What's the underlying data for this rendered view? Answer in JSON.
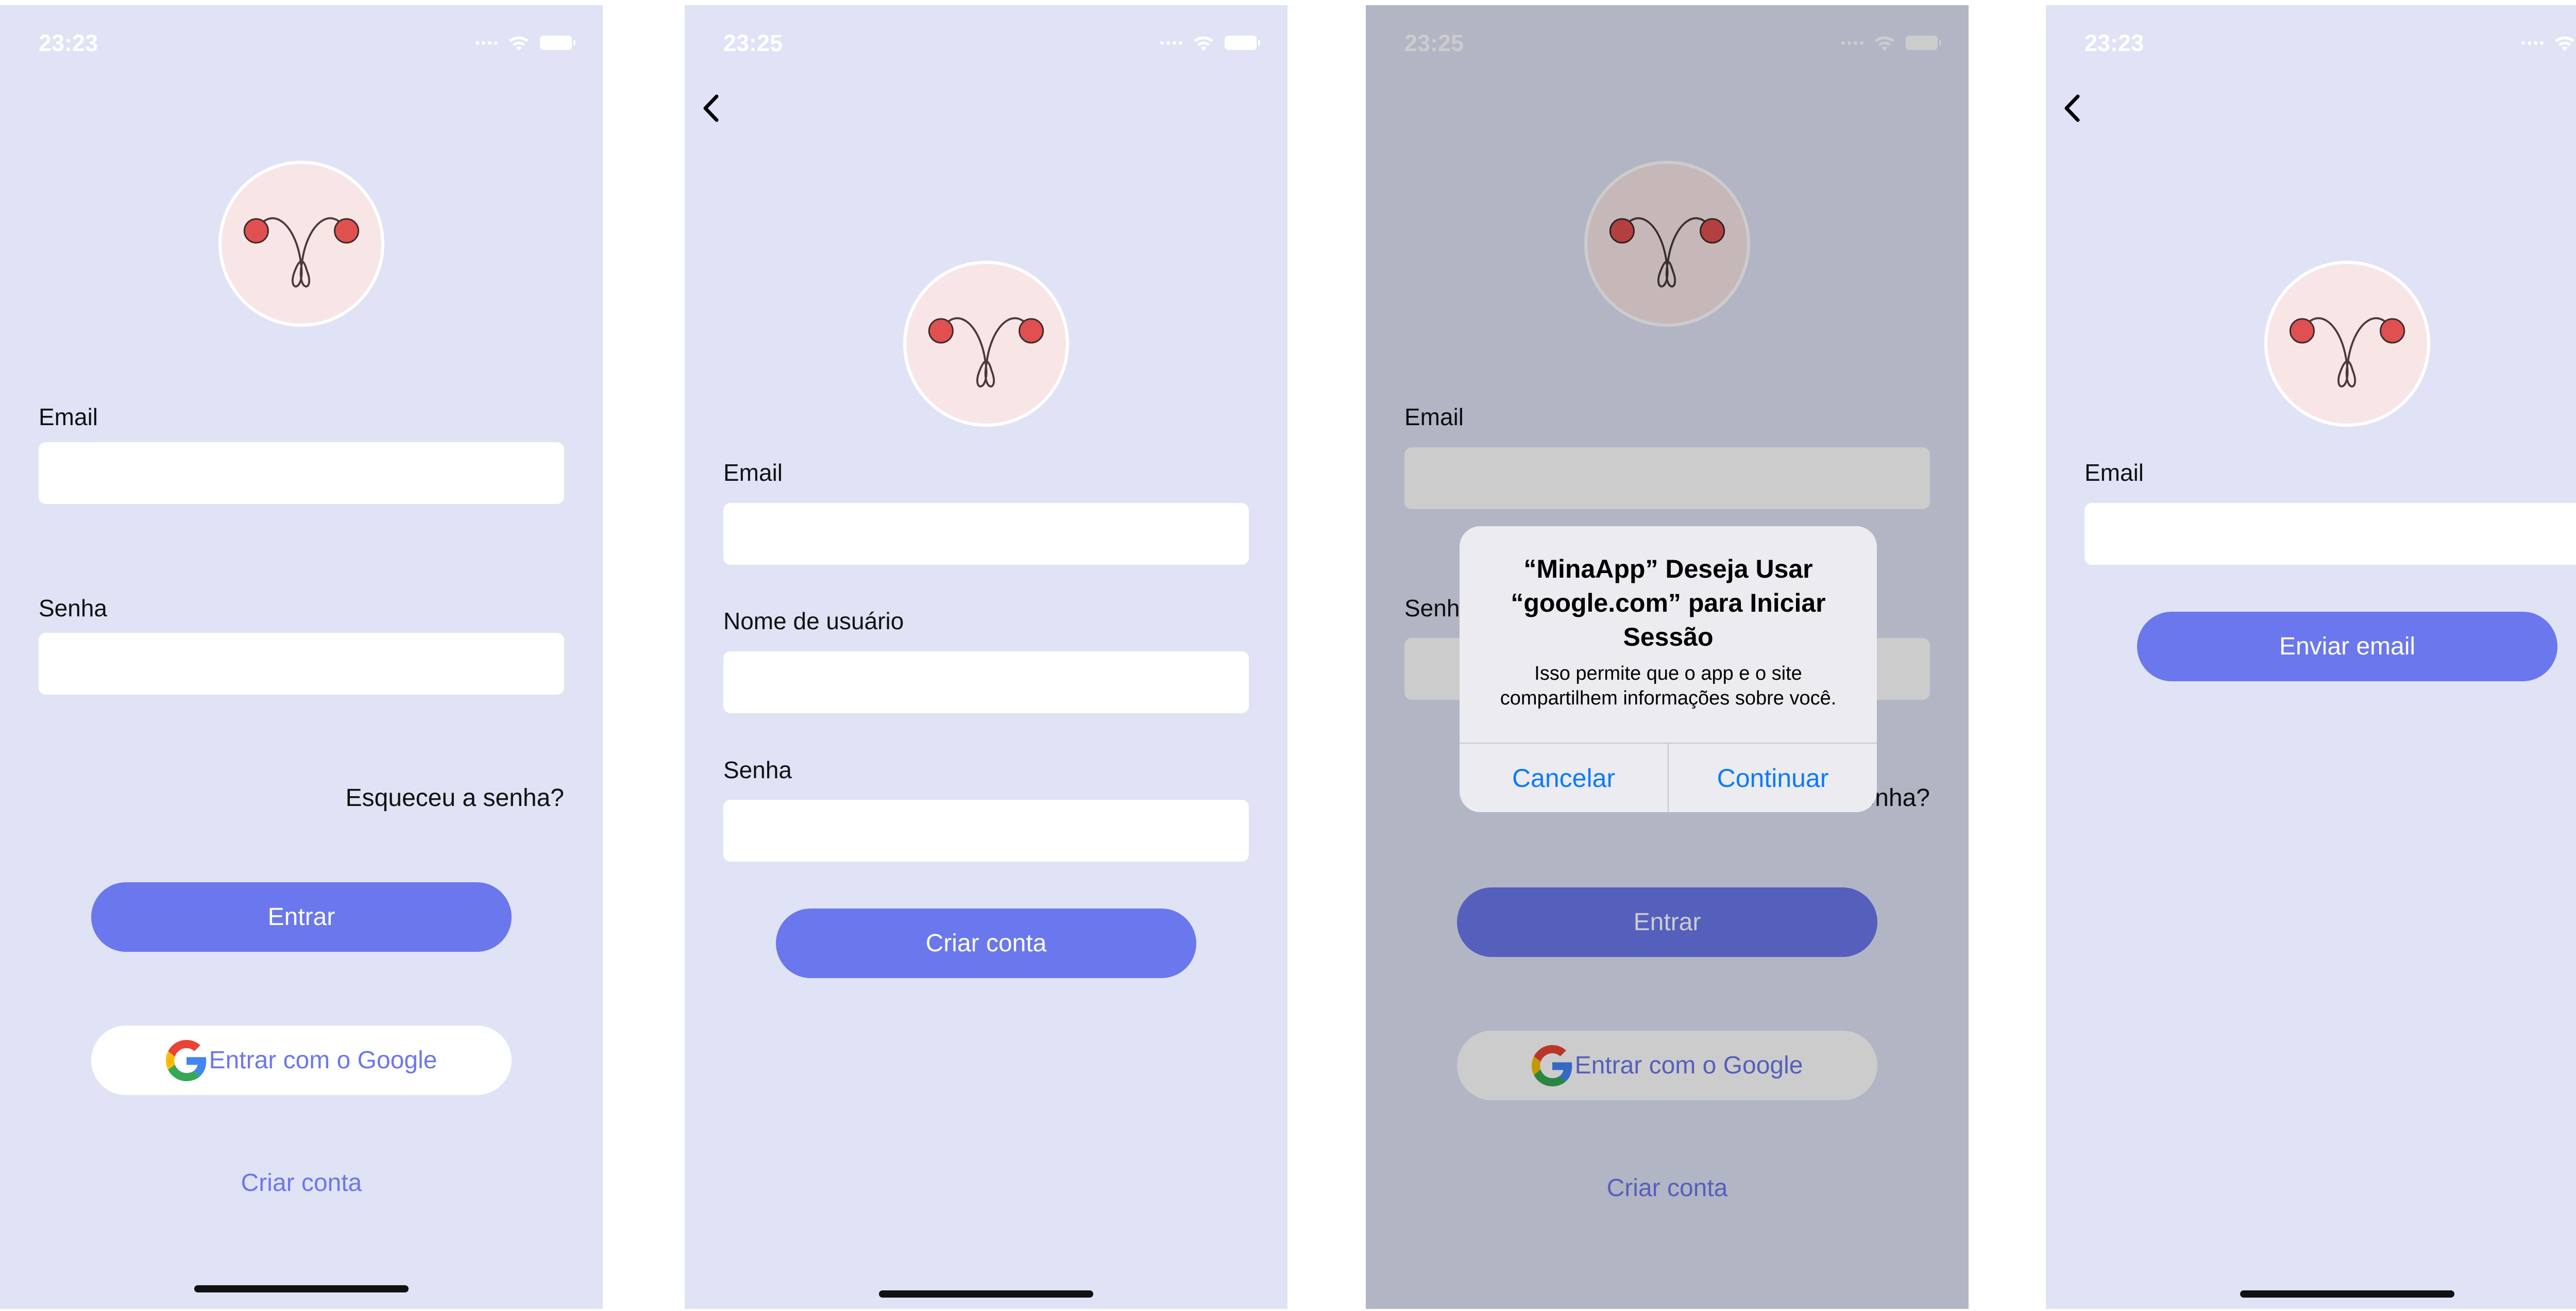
{
  "status_bar": {
    "time_a": "23:23",
    "time_b": "23:25"
  },
  "login": {
    "email_label": "Email",
    "password_label": "Senha",
    "forgot_link": "Esqueceu a senha?",
    "enter_button": "Entrar",
    "google_button": "Entrar com o Google",
    "create_account_link": "Criar conta"
  },
  "signup": {
    "email_label": "Email",
    "username_label": "Nome de usuário",
    "password_label": "Senha",
    "create_button": "Criar conta"
  },
  "alert": {
    "title": "“MinaApp” Deseja Usar “google.com” para Iniciar Sessão",
    "message": "Isso permite que o app e o site compartilhem informações sobre você.",
    "cancel_button": "Cancelar",
    "continue_button": "Continuar"
  },
  "reset": {
    "email_label": "Email",
    "send_button": "Enviar email"
  },
  "icons": [
    "chevron-left-icon",
    "wifi-icon",
    "battery-icon",
    "signal-icon",
    "google-g-icon",
    "app-logo-icon"
  ],
  "colors": {
    "background": "#dfe3f5",
    "accent": "#6b77ec",
    "logo_bg": "#f8e6e6",
    "logo_red": "#e05050",
    "alert_link": "#0a7aff"
  }
}
